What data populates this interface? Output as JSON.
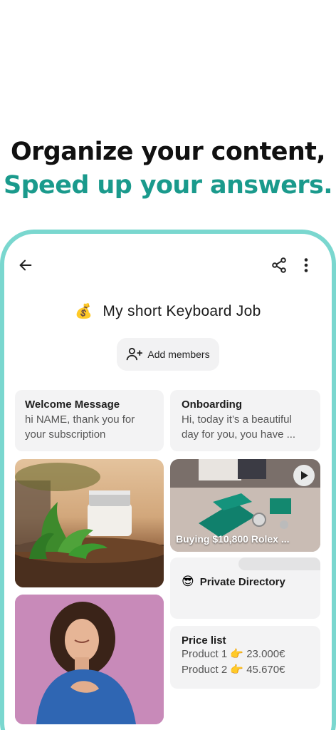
{
  "headline": {
    "line1": "Organize your content,",
    "line2": "Speed up your answers."
  },
  "colors": {
    "accent": "#1a9a8c",
    "frame": "#7ad7cf"
  },
  "topbar": {
    "back_icon": "arrow-left-icon",
    "share_icon": "share-icon",
    "more_icon": "more-vertical-icon"
  },
  "folder": {
    "emoji": "💰",
    "title": "My short Keyboard Job"
  },
  "add_members": {
    "label": "Add members",
    "icon": "add-person-icon"
  },
  "cards": {
    "welcome": {
      "title": "Welcome Message",
      "body": "hi NAME, thank you for your subscription"
    },
    "onboarding": {
      "title": "Onboarding",
      "body": "Hi, today it’s a beautiful day for you, you have ..."
    },
    "video": {
      "caption": "Buying $10,800 Rolex ..."
    },
    "private_directory": {
      "emoji": "😎",
      "title": "Private Directory"
    },
    "price_list": {
      "title": "Price list",
      "line1": "Product 1 👉 23.000€",
      "line2": "Product 2 👉 45.670€"
    }
  }
}
